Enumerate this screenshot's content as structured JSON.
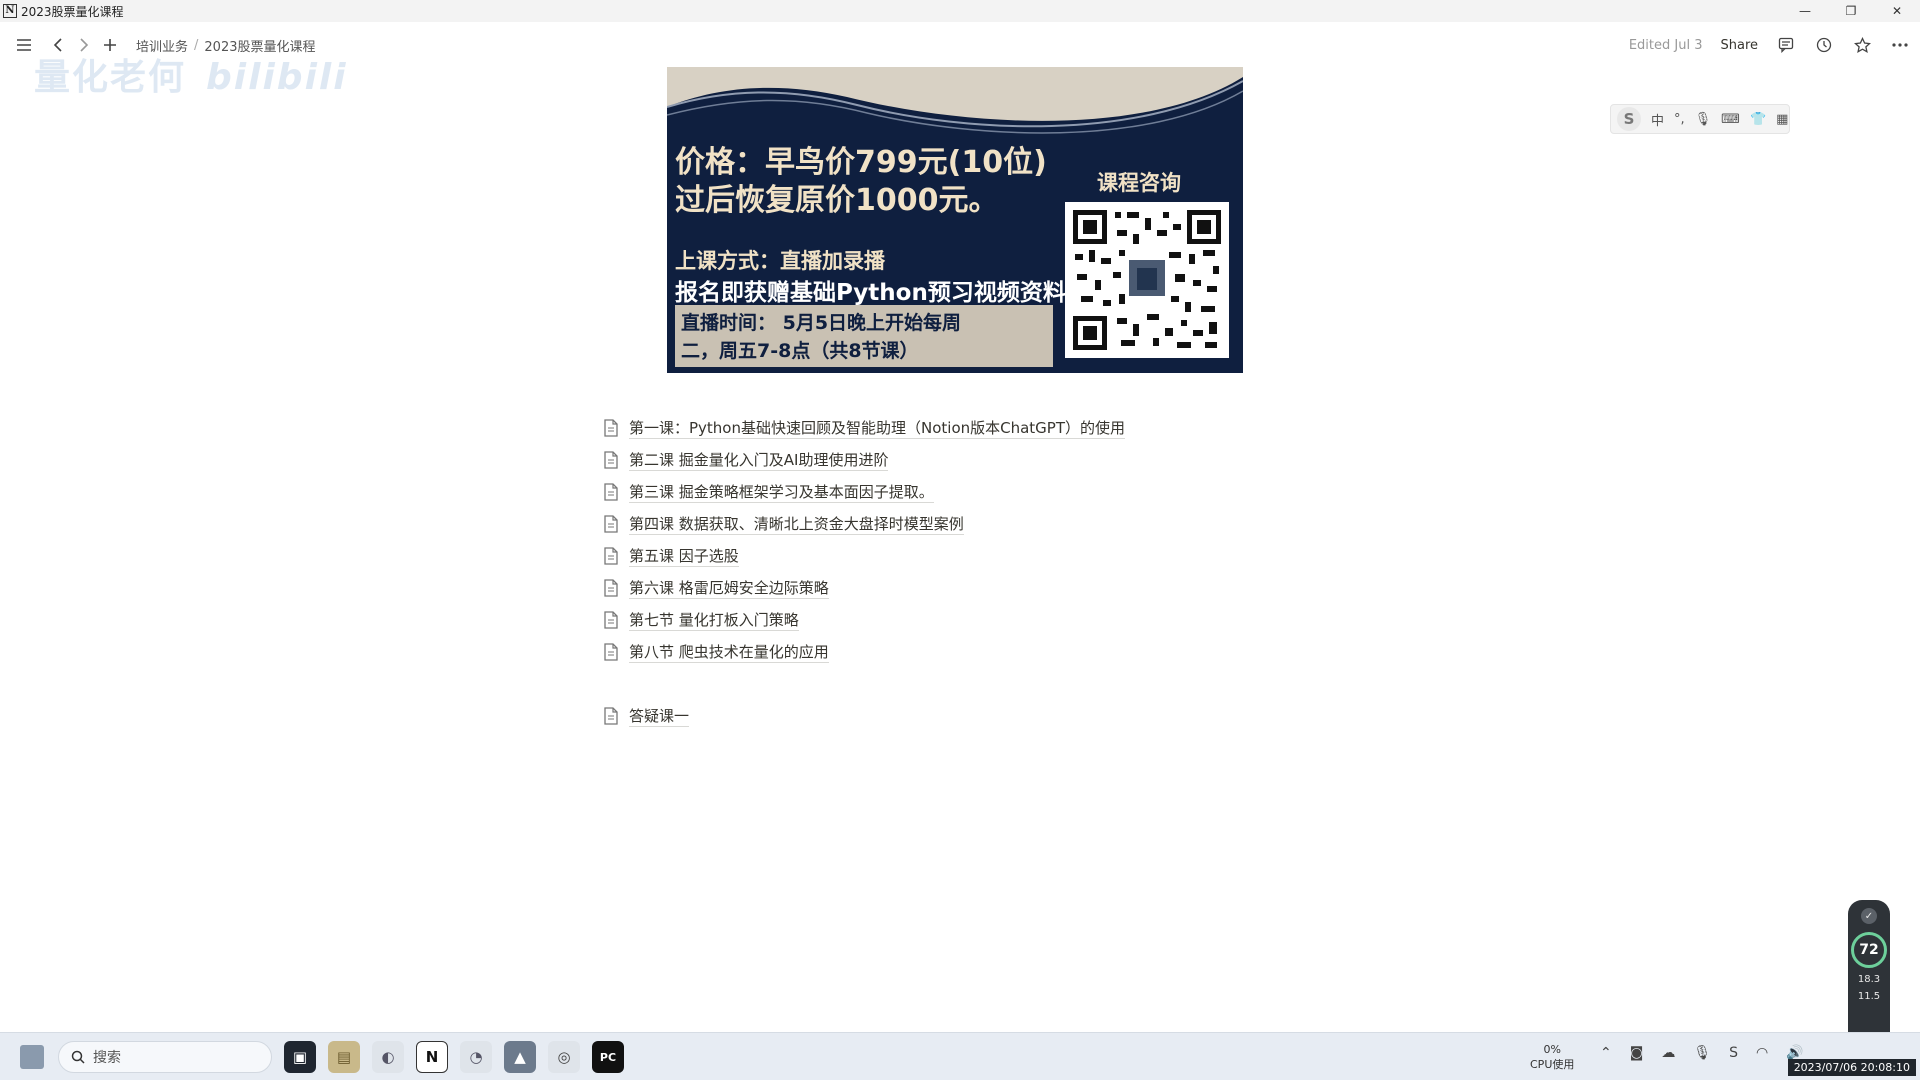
{
  "window": {
    "title": "2023股票量化课程",
    "app_icon": "N",
    "controls": [
      "—",
      "❐",
      "✕"
    ]
  },
  "topbar": {
    "breadcrumbs": [
      "培训业务",
      "2023股票量化课程"
    ],
    "edited": "Edited Jul 3",
    "share": "Share"
  },
  "watermark": {
    "left": "量化老何",
    "right": "bilibili"
  },
  "ime": {
    "logo": "S",
    "mode": "中",
    "punct": "°,"
  },
  "banner": {
    "price_line1": "价格：早鸟价799元(10位)",
    "price_line2": "过后恢复原价1000元。",
    "method": "上课方式：直播加录播",
    "gift": "报名即获赠基础Python预习视频资料。",
    "live_line1": "直播时间： 5月5日晚上开始每周",
    "live_line2": "二，周五7-8点（共8节课）",
    "consult": "课程咨询"
  },
  "pages": [
    {
      "label": "第一课：Python基础快速回顾及智能助理（Notion版本ChatGPT）的使用"
    },
    {
      "label": "第二课 掘金量化入门及AI助理使用进阶"
    },
    {
      "label": "第三课 掘金策略框架学习及基本面因子提取。"
    },
    {
      "label": "第四课 数据获取、清晰北上资金大盘择时模型案例"
    },
    {
      "label": "第五课 因子选股"
    },
    {
      "label": "第六课 格雷厄姆安全边际策略"
    },
    {
      "label": "第七节 量化打板入门策略"
    },
    {
      "label": "第八节 爬虫技术在量化的应用"
    }
  ],
  "qa_page": {
    "label": "答疑课一"
  },
  "widget": {
    "score": "72",
    "v1": "18.3",
    "v2": "11.5"
  },
  "taskbar": {
    "search_placeholder": "搜索",
    "cpu_percent": "0%",
    "cpu_label": "CPU使用",
    "clock": "2023/07/06 20:08:10"
  }
}
